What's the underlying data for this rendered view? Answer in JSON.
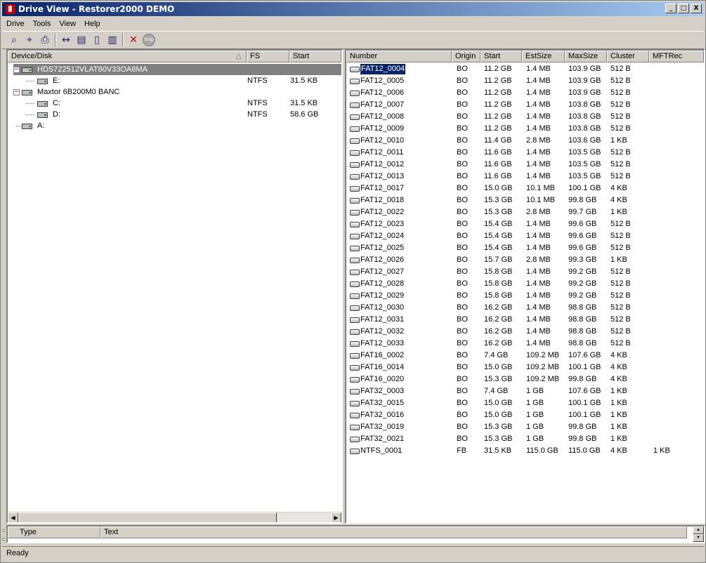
{
  "window": {
    "title": "Drive View - Restorer2000 DEMO",
    "min_label": "_",
    "max_label": "□",
    "close_label": "X"
  },
  "menu": [
    "Drive",
    "Tools",
    "View",
    "Help"
  ],
  "toolbar": {
    "icons": [
      "scan-icon",
      "search-icon",
      "print-icon",
      "resize-icon",
      "open-icon",
      "copy-icon",
      "paste-icon",
      "delete-icon",
      "stop-icon"
    ],
    "glyphs": [
      "⌕",
      "⌖",
      "⎙",
      "↔",
      "▤",
      "▯",
      "▥",
      "✕",
      "●"
    ],
    "stop_label": "Stop"
  },
  "left_pane": {
    "columns": [
      "Device/Disk",
      "FS",
      "Start"
    ],
    "sort_glyph": "△",
    "rows": [
      {
        "level": 0,
        "expander": "−",
        "name": "HDS722512VLAT80V33OA6MA",
        "fs": "",
        "start": "",
        "selected": true
      },
      {
        "level": 1,
        "expander": "",
        "name": "E:",
        "fs": "NTFS",
        "start": "31.5 KB",
        "selected": false
      },
      {
        "level": 0,
        "expander": "−",
        "name": "Maxtor 6B200M0 BANC",
        "fs": "",
        "start": "",
        "selected": false
      },
      {
        "level": 1,
        "expander": "",
        "name": "C:",
        "fs": "NTFS",
        "start": "31.5 KB",
        "selected": false
      },
      {
        "level": 1,
        "expander": "",
        "name": "D:",
        "fs": "NTFS",
        "start": "58.6 GB",
        "selected": false
      },
      {
        "level": 0,
        "expander": "",
        "name": "A:",
        "fs": "",
        "start": "",
        "selected": false
      }
    ]
  },
  "right_pane": {
    "columns": [
      "Number",
      "Origin",
      "Start",
      "EstSize",
      "MaxSize",
      "Cluster",
      "MFTRec"
    ],
    "rows": [
      [
        "FAT12_0004",
        "BO",
        "11.2 GB",
        "1.4 MB",
        "103.9 GB",
        "512 B",
        ""
      ],
      [
        "FAT12_0005",
        "BO",
        "11.2 GB",
        "1.4 MB",
        "103.9 GB",
        "512 B",
        ""
      ],
      [
        "FAT12_0006",
        "BO",
        "11.2 GB",
        "1.4 MB",
        "103.9 GB",
        "512 B",
        ""
      ],
      [
        "FAT12_0007",
        "BO",
        "11.2 GB",
        "1.4 MB",
        "103.8 GB",
        "512 B",
        ""
      ],
      [
        "FAT12_0008",
        "BO",
        "11.2 GB",
        "1.4 MB",
        "103.8 GB",
        "512 B",
        ""
      ],
      [
        "FAT12_0009",
        "BO",
        "11.2 GB",
        "1.4 MB",
        "103.8 GB",
        "512 B",
        ""
      ],
      [
        "FAT12_0010",
        "BO",
        "11.4 GB",
        "2.8 MB",
        "103.6 GB",
        "1 KB",
        ""
      ],
      [
        "FAT12_0011",
        "BO",
        "11.6 GB",
        "1.4 MB",
        "103.5 GB",
        "512 B",
        ""
      ],
      [
        "FAT12_0012",
        "BO",
        "11.6 GB",
        "1.4 MB",
        "103.5 GB",
        "512 B",
        ""
      ],
      [
        "FAT12_0013",
        "BO",
        "11.6 GB",
        "1.4 MB",
        "103.5 GB",
        "512 B",
        ""
      ],
      [
        "FAT12_0017",
        "BO",
        "15.0 GB",
        "10.1 MB",
        "100.1 GB",
        "4 KB",
        ""
      ],
      [
        "FAT12_0018",
        "BO",
        "15.3 GB",
        "10.1 MB",
        "99.8 GB",
        "4 KB",
        ""
      ],
      [
        "FAT12_0022",
        "BO",
        "15.3 GB",
        "2.8 MB",
        "99.7 GB",
        "1 KB",
        ""
      ],
      [
        "FAT12_0023",
        "BO",
        "15.4 GB",
        "1.4 MB",
        "99.6 GB",
        "512 B",
        ""
      ],
      [
        "FAT12_0024",
        "BO",
        "15.4 GB",
        "1.4 MB",
        "99.6 GB",
        "512 B",
        ""
      ],
      [
        "FAT12_0025",
        "BO",
        "15.4 GB",
        "1.4 MB",
        "99.6 GB",
        "512 B",
        ""
      ],
      [
        "FAT12_0026",
        "BO",
        "15.7 GB",
        "2.8 MB",
        "99.3 GB",
        "1 KB",
        ""
      ],
      [
        "FAT12_0027",
        "BO",
        "15.8 GB",
        "1.4 MB",
        "99.2 GB",
        "512 B",
        ""
      ],
      [
        "FAT12_0028",
        "BO",
        "15.8 GB",
        "1.4 MB",
        "99.2 GB",
        "512 B",
        ""
      ],
      [
        "FAT12_0029",
        "BO",
        "15.8 GB",
        "1.4 MB",
        "99.2 GB",
        "512 B",
        ""
      ],
      [
        "FAT12_0030",
        "BO",
        "16.2 GB",
        "1.4 MB",
        "98.8 GB",
        "512 B",
        ""
      ],
      [
        "FAT12_0031",
        "BO",
        "16.2 GB",
        "1.4 MB",
        "98.8 GB",
        "512 B",
        ""
      ],
      [
        "FAT12_0032",
        "BO",
        "16.2 GB",
        "1.4 MB",
        "98.8 GB",
        "512 B",
        ""
      ],
      [
        "FAT12_0033",
        "BO",
        "16.2 GB",
        "1.4 MB",
        "98.8 GB",
        "512 B",
        ""
      ],
      [
        "FAT16_0002",
        "BO",
        "7.4 GB",
        "109.2 MB",
        "107.6 GB",
        "4 KB",
        ""
      ],
      [
        "FAT16_0014",
        "BO",
        "15.0 GB",
        "109.2 MB",
        "100.1 GB",
        "4 KB",
        ""
      ],
      [
        "FAT16_0020",
        "BO",
        "15.3 GB",
        "109.2 MB",
        "99.8 GB",
        "4 KB",
        ""
      ],
      [
        "FAT32_0003",
        "BO",
        "7.4 GB",
        "1 GB",
        "107.6 GB",
        "1 KB",
        ""
      ],
      [
        "FAT32_0015",
        "BO",
        "15.0 GB",
        "1 GB",
        "100.1 GB",
        "1 KB",
        ""
      ],
      [
        "FAT32_0016",
        "BO",
        "15.0 GB",
        "1 GB",
        "100.1 GB",
        "1 KB",
        ""
      ],
      [
        "FAT32_0019",
        "BO",
        "15.3 GB",
        "1 GB",
        "99.8 GB",
        "1 KB",
        ""
      ],
      [
        "FAT32_0021",
        "BO",
        "15.3 GB",
        "1 GB",
        "99.8 GB",
        "1 KB",
        ""
      ],
      [
        "NTFS_0001",
        "FB",
        "31.5 KB",
        "115.0 GB",
        "115.0 GB",
        "4 KB",
        "1 KB"
      ]
    ],
    "selected_index": 0
  },
  "log_pane": {
    "columns": [
      "Type",
      "Text"
    ]
  },
  "scroll": {
    "left": "◀",
    "right": "▶",
    "up": "▲",
    "down": "▼"
  },
  "status": {
    "text": "Ready"
  },
  "colors": {
    "title_start": "#0a246a",
    "title_end": "#a6caf0",
    "face": "#d4d0c8",
    "selection": "#808080",
    "delete": "#c00000"
  }
}
